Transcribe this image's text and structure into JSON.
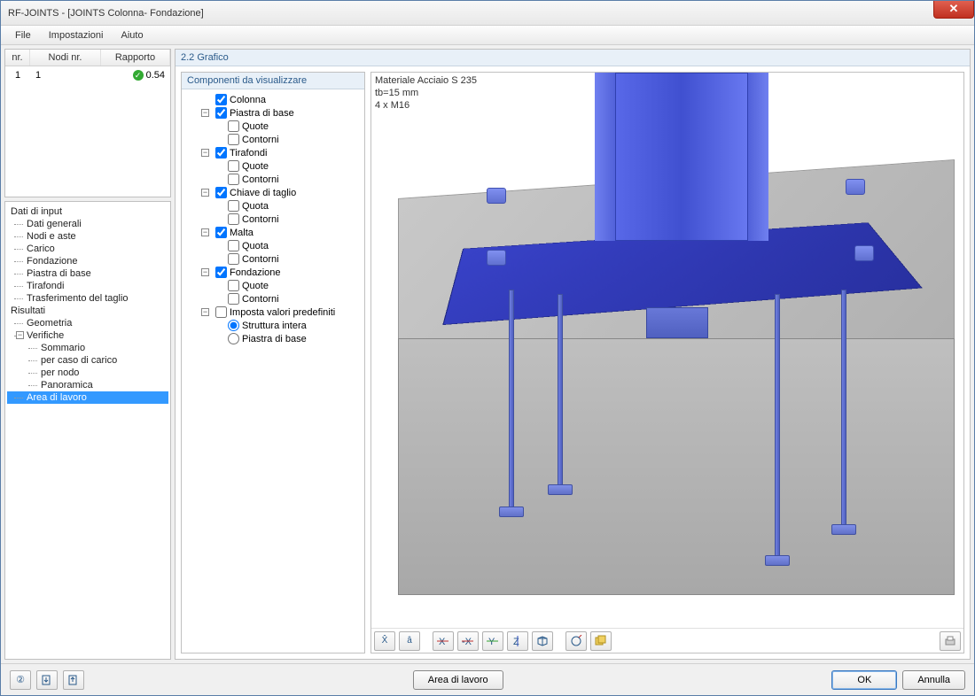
{
  "window": {
    "title": "RF-JOINTS - [JOINTS Colonna- Fondazione]"
  },
  "menu": {
    "file": "File",
    "settings": "Impostazioni",
    "help": "Aiuto"
  },
  "grid": {
    "headers": {
      "nr": "nr.",
      "nodi": "Nodi nr.",
      "rapporto": "Rapporto"
    },
    "rows": [
      {
        "nr": "1",
        "nodi": "1",
        "rapporto": "0.54"
      }
    ]
  },
  "nav": {
    "input_root": "Dati di input",
    "input": [
      "Dati generali",
      "Nodi e aste",
      "Carico",
      "Fondazione",
      "Piastra di base",
      "Tirafondi",
      "Trasferimento del taglio"
    ],
    "results_root": "Risultati",
    "geometria": "Geometria",
    "verifiche": "Verifiche",
    "verifiche_children": [
      "Sommario",
      "per caso di carico",
      "per nodo",
      "Panoramica"
    ],
    "selected": "Area di lavoro"
  },
  "right": {
    "title": "2.2 Grafico"
  },
  "components": {
    "title": "Componenti da visualizzare",
    "colonna": "Colonna",
    "piastra": "Piastra di base",
    "quote": "Quote",
    "quota": "Quota",
    "contorni": "Contorni",
    "tirafondi": "Tirafondi",
    "chiave": "Chiave di taglio",
    "malta": "Malta",
    "fondazione": "Fondazione",
    "imposta": "Imposta valori predefiniti",
    "struttura": "Struttura intera",
    "piastra_base": "Piastra di base"
  },
  "viewport": {
    "line1": "Materiale Acciaio S 235",
    "line2": "tb=15 mm",
    "line3": "4 x M16"
  },
  "footer": {
    "area": "Area di lavoro",
    "ok": "OK",
    "annulla": "Annulla"
  }
}
